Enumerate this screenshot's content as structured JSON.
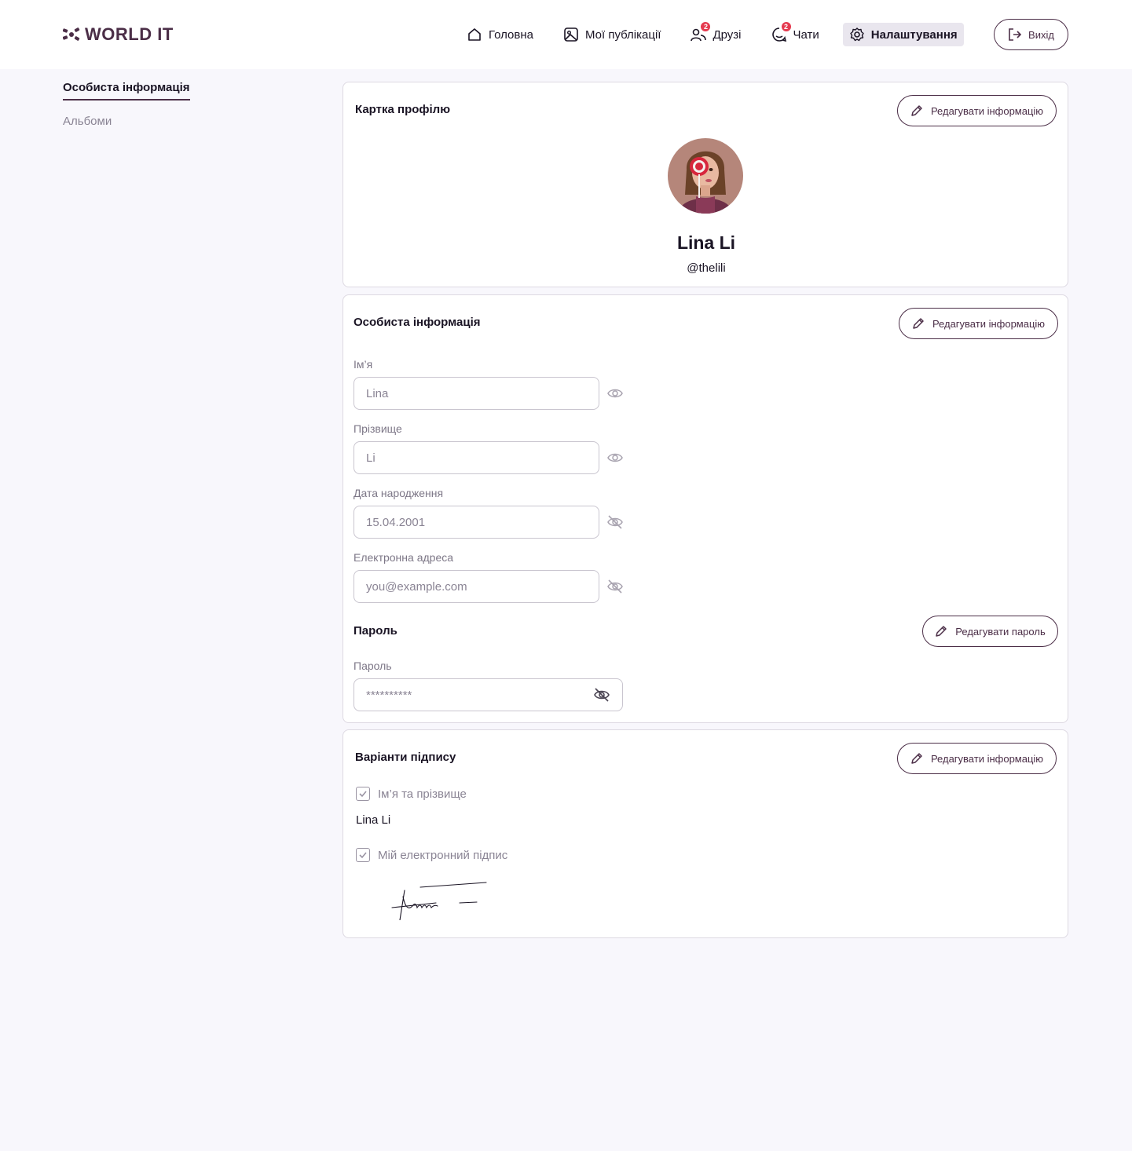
{
  "brand": {
    "name": "WORLD IT",
    "color": "#4b2e47"
  },
  "nav": {
    "items": [
      {
        "label": "Головна",
        "icon": "home-icon"
      },
      {
        "label": "Мої публікації",
        "icon": "image-icon"
      },
      {
        "label": "Друзі",
        "icon": "friends-icon",
        "badge": "2"
      },
      {
        "label": "Чати",
        "icon": "chat-icon",
        "badge": "2"
      },
      {
        "label": "Налаштування",
        "icon": "gear-icon",
        "active": true
      }
    ],
    "logout_label": "Вихід"
  },
  "sidebar": {
    "items": [
      {
        "label": "Особиста інформація",
        "active": true
      },
      {
        "label": "Альбоми"
      }
    ]
  },
  "profile_card": {
    "title": "Картка профілю",
    "edit_label": "Редагувати інформацію",
    "name": "Lina Li",
    "handle": "@thelili"
  },
  "personal_info": {
    "title": "Особиста інформація",
    "edit_label": "Редагувати інформацію",
    "fields": [
      {
        "label": "Ім’я",
        "value": "Lina",
        "visible": true
      },
      {
        "label": "Прізвище",
        "value": "Li",
        "visible": true
      },
      {
        "label": "Дата народження",
        "value": "15.04.2001",
        "visible": false
      },
      {
        "label": "Електронна адреса",
        "placeholder": "you@example.com",
        "visible": false
      }
    ],
    "password": {
      "title": "Пароль",
      "edit_label": "Редагувати пароль",
      "label": "Пароль",
      "value": "**********"
    }
  },
  "signature": {
    "title": "Варіанти підпису",
    "edit_label": "Редагувати інформацію",
    "options": [
      {
        "label": "Ім’я та прізвище",
        "checked": true
      },
      {
        "label": "Мій електронний підпис",
        "checked": true
      }
    ],
    "name_text": "Lina Li"
  },
  "colors": {
    "accent": "#4b2e47",
    "badge": "#e53a4f",
    "background": "#f8f7fc"
  }
}
